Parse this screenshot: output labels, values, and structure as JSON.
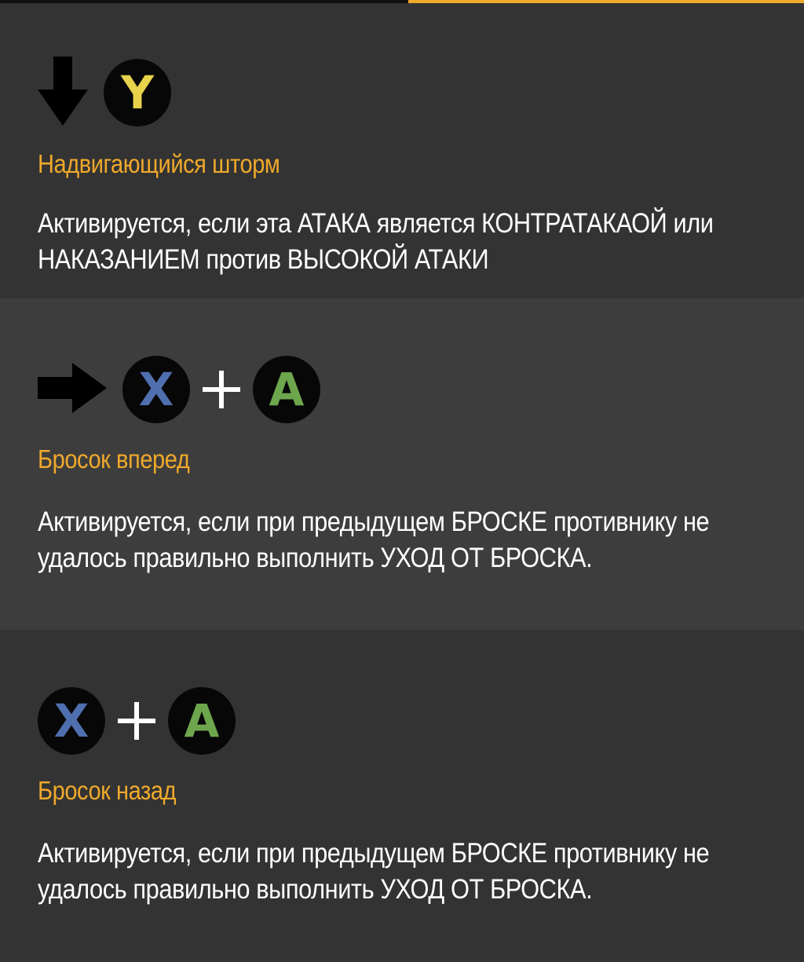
{
  "tabs": [
    {
      "name": "tab-left",
      "active": false
    },
    {
      "name": "tab-right",
      "active": true
    }
  ],
  "colors": {
    "accent": "#f0a92b",
    "button_y": "#e7d24c",
    "button_x": "#4f6fae",
    "button_a": "#6ea64d",
    "card_dark": "#333333",
    "card_light": "#3d3d3d"
  },
  "moves": [
    {
      "direction_icon": "arrow-down-icon",
      "buttons": [
        "Y"
      ],
      "name": "Надвигающийся шторм",
      "description": "Активируется, если эта АТАКА является КОНТРАТАКАОЙ или НАКАЗАНИЕМ против ВЫСОКОЙ АТАКИ"
    },
    {
      "direction_icon": "arrow-right-icon",
      "buttons": [
        "X",
        "+",
        "A"
      ],
      "name": "Бросок вперед",
      "description": "Активируется, если при предыдущем БРОСКЕ противнику не удалось правильно выполнить УХОД ОТ БРОСКА."
    },
    {
      "direction_icon": "",
      "buttons": [
        "X",
        "+",
        "A"
      ],
      "name": "Бросок назад",
      "description": "Активируется, если при предыдущем БРОСКЕ противнику не удалось правильно выполнить УХОД ОТ БРОСКА."
    }
  ]
}
